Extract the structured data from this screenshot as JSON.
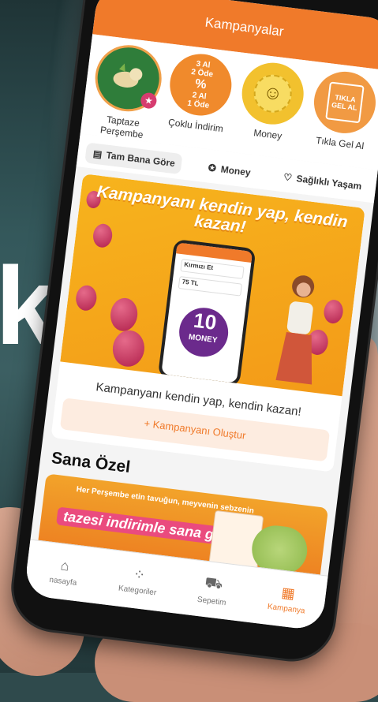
{
  "header": {
    "title": "Kampanyalar"
  },
  "background": {
    "big_letter": "k"
  },
  "campaign_circles": [
    {
      "label": "Taptaze Perşembe",
      "icon": "vegetables-icon"
    },
    {
      "label": "Çoklu İndirim",
      "icon": "multi-discount-icon",
      "badge_lines": [
        "3 Al",
        "2 Öde",
        "2 Al",
        "1 Öde"
      ],
      "percent": "%"
    },
    {
      "label": "Money",
      "icon": "money-smiley-icon"
    },
    {
      "label": "Tıkla Gel Al",
      "icon": "shopping-bag-icon",
      "badge_lines": [
        "TIKLA",
        "GEL AL"
      ]
    }
  ],
  "tabs": [
    {
      "label": "Tam Bana Göre",
      "icon": "document-icon",
      "active": true
    },
    {
      "label": "Money",
      "icon": "money-badge-icon",
      "active": false
    },
    {
      "label": "Sağlıklı Yaşam",
      "icon": "heartbeat-icon",
      "active": false
    }
  ],
  "promo": {
    "banner_title": "Kampanyanı kendin yap, kendin kazan!",
    "mini_form": {
      "field1": "Kırmızı Et",
      "field2": "75 TL"
    },
    "money_amount": "10",
    "money_label": "MONEY",
    "subtitle": "Kampanyanı kendin yap, kendin kazan!",
    "create_button": "+ Kampanyanı Oluştur"
  },
  "special": {
    "title": "Sana Özel",
    "banner_small": "Her Perşembe etin tavuğun, meyvenin sebzenin",
    "banner_big": "tazesi indirimle sana geliyor!"
  },
  "bottom_nav": [
    {
      "label": "nasayfa",
      "icon": "home-icon",
      "active": false
    },
    {
      "label": "Kategoriler",
      "icon": "categories-icon",
      "active": false
    },
    {
      "label": "Sepetim",
      "icon": "cart-icon",
      "active": false
    },
    {
      "label": "Kampanya",
      "icon": "campaigns-icon",
      "active": true
    }
  ],
  "colors": {
    "brand_orange": "#f07a2a",
    "money_purple": "#6b2a8c"
  }
}
